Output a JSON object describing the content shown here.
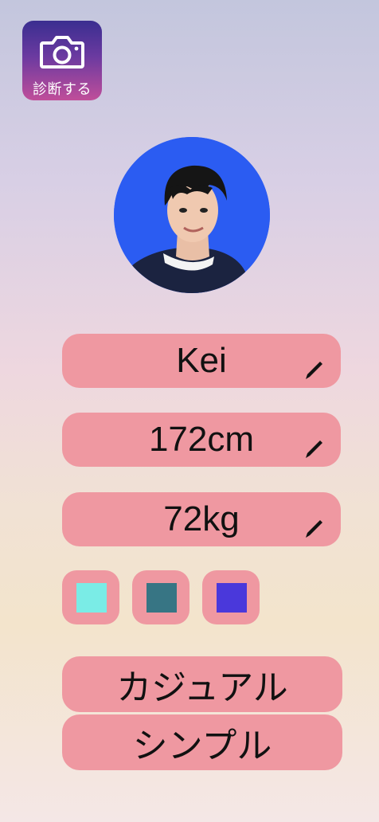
{
  "diagnose_button": {
    "label": "診断する",
    "icon": "camera-icon"
  },
  "profile": {
    "avatar": "profile-photo",
    "name": "Kei",
    "height": "172cm",
    "weight": "72kg",
    "edit_icon": "pencil-icon"
  },
  "colors": [
    {
      "name": "swatch-1",
      "hex": "#7aece6"
    },
    {
      "name": "swatch-2",
      "hex": "#377584"
    },
    {
      "name": "swatch-3",
      "hex": "#4a38db"
    }
  ],
  "styles": [
    "カジュアル",
    "シンプル"
  ]
}
